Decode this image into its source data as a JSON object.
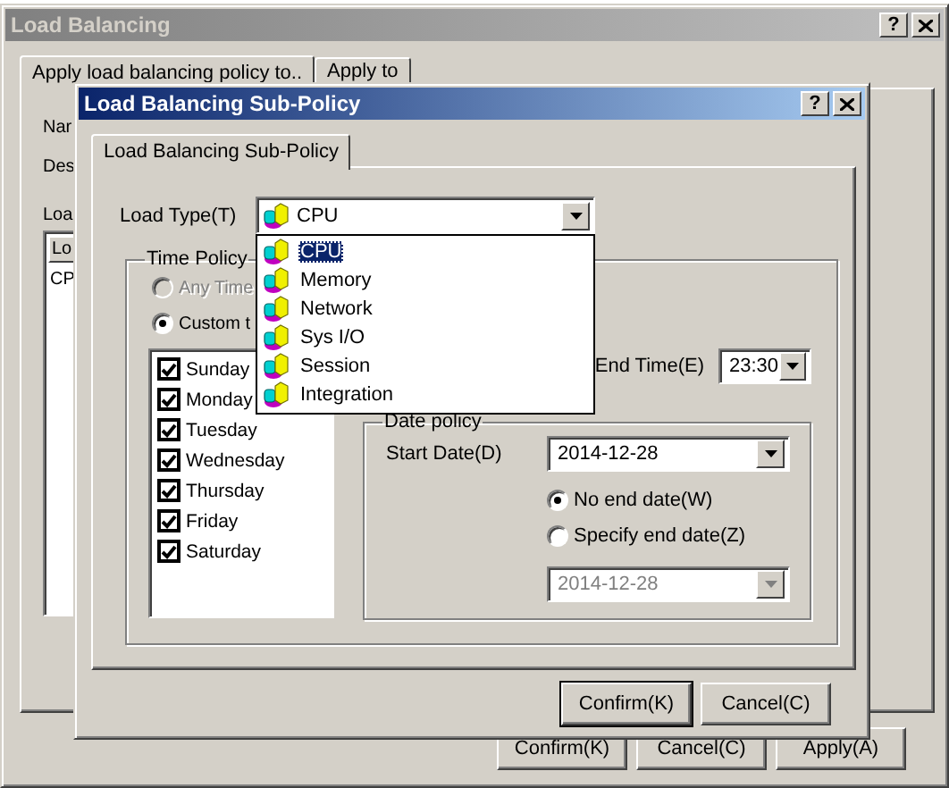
{
  "background_window": {
    "title": "Load Balancing",
    "active": false,
    "help_button": "?",
    "tabs": [
      {
        "label": "Apply load balancing policy to..",
        "selected": true
      },
      {
        "label": "Apply to",
        "selected": false
      }
    ],
    "field_labels": [
      "Nar",
      "Des"
    ],
    "list_label": "Loa",
    "list": {
      "column": "Lo",
      "rows": [
        "CP"
      ]
    },
    "buttons": [
      {
        "label": "Confirm(K)",
        "default": false
      },
      {
        "label": "Cancel(C)",
        "default": false
      },
      {
        "label": "Apply(A)",
        "default": false
      }
    ]
  },
  "dialog": {
    "title": "Load Balancing Sub-Policy",
    "active": true,
    "help_button": "?",
    "tabs": [
      {
        "label": "Load Balancing Sub-Policy",
        "selected": true
      }
    ],
    "load_type": {
      "label": "Load Type(T)",
      "value": "CPU",
      "expanded": true,
      "options": [
        {
          "label": "CPU",
          "selected": true
        },
        {
          "label": "Memory",
          "selected": false
        },
        {
          "label": "Network",
          "selected": false
        },
        {
          "label": "Sys I/O",
          "selected": false
        },
        {
          "label": "Session",
          "selected": false
        },
        {
          "label": "Integration",
          "selected": false
        }
      ]
    },
    "time_policy": {
      "title": "Time Policy",
      "modes": [
        {
          "label": "Any Time",
          "selected": false,
          "disabled": true
        },
        {
          "label": "Custom t",
          "selected": true,
          "disabled": false
        }
      ],
      "days": [
        {
          "label": "Sunday",
          "checked": true
        },
        {
          "label": "Monday",
          "checked": true
        },
        {
          "label": "Tuesday",
          "checked": true
        },
        {
          "label": "Wednesday",
          "checked": true
        },
        {
          "label": "Thursday",
          "checked": true
        },
        {
          "label": "Friday",
          "checked": true
        },
        {
          "label": "Saturday",
          "checked": true
        }
      ],
      "end_time": {
        "label": "End Time(E)",
        "value": "23:30"
      },
      "date_policy": {
        "title": "Date policy",
        "start_date": {
          "label": "Start Date(D)",
          "value": "2014-12-28"
        },
        "end_options": [
          {
            "label": "No end date(W)",
            "selected": true
          },
          {
            "label": "Specify end date(Z)",
            "selected": false
          }
        ],
        "end_date": {
          "value": "2014-12-28",
          "disabled": true
        }
      }
    },
    "buttons": [
      {
        "label": "Confirm(K)",
        "default": true
      },
      {
        "label": "Cancel(C)",
        "default": false
      }
    ]
  }
}
